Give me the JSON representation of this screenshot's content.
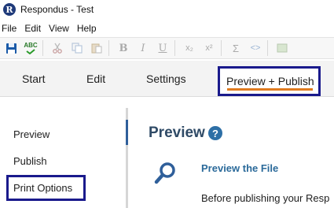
{
  "window": {
    "title": "Respondus - Test",
    "logo_letter": "R"
  },
  "menu": [
    "File",
    "Edit",
    "View",
    "Help"
  ],
  "toolbar": {
    "spell_label": "ABC",
    "bold": "B",
    "italic": "I",
    "underline": "U",
    "subscript": "x₂",
    "superscript": "x²",
    "sigma": "Σ",
    "code": "<>"
  },
  "tabs": {
    "start": "Start",
    "edit": "Edit",
    "settings": "Settings",
    "preview_publish": "Preview + Publish"
  },
  "leftnav": {
    "preview": "Preview",
    "publish": "Publish",
    "print_options": "Print Options"
  },
  "main": {
    "title": "Preview",
    "help_glyph": "?",
    "section_link": "Preview the File",
    "section_desc": "Before publishing your Resp"
  },
  "colors": {
    "highlight_box": "#1a1a8c",
    "active_tab_underline": "#e07b1f",
    "title_text": "#2f4a66",
    "link": "#2b6a9a"
  }
}
